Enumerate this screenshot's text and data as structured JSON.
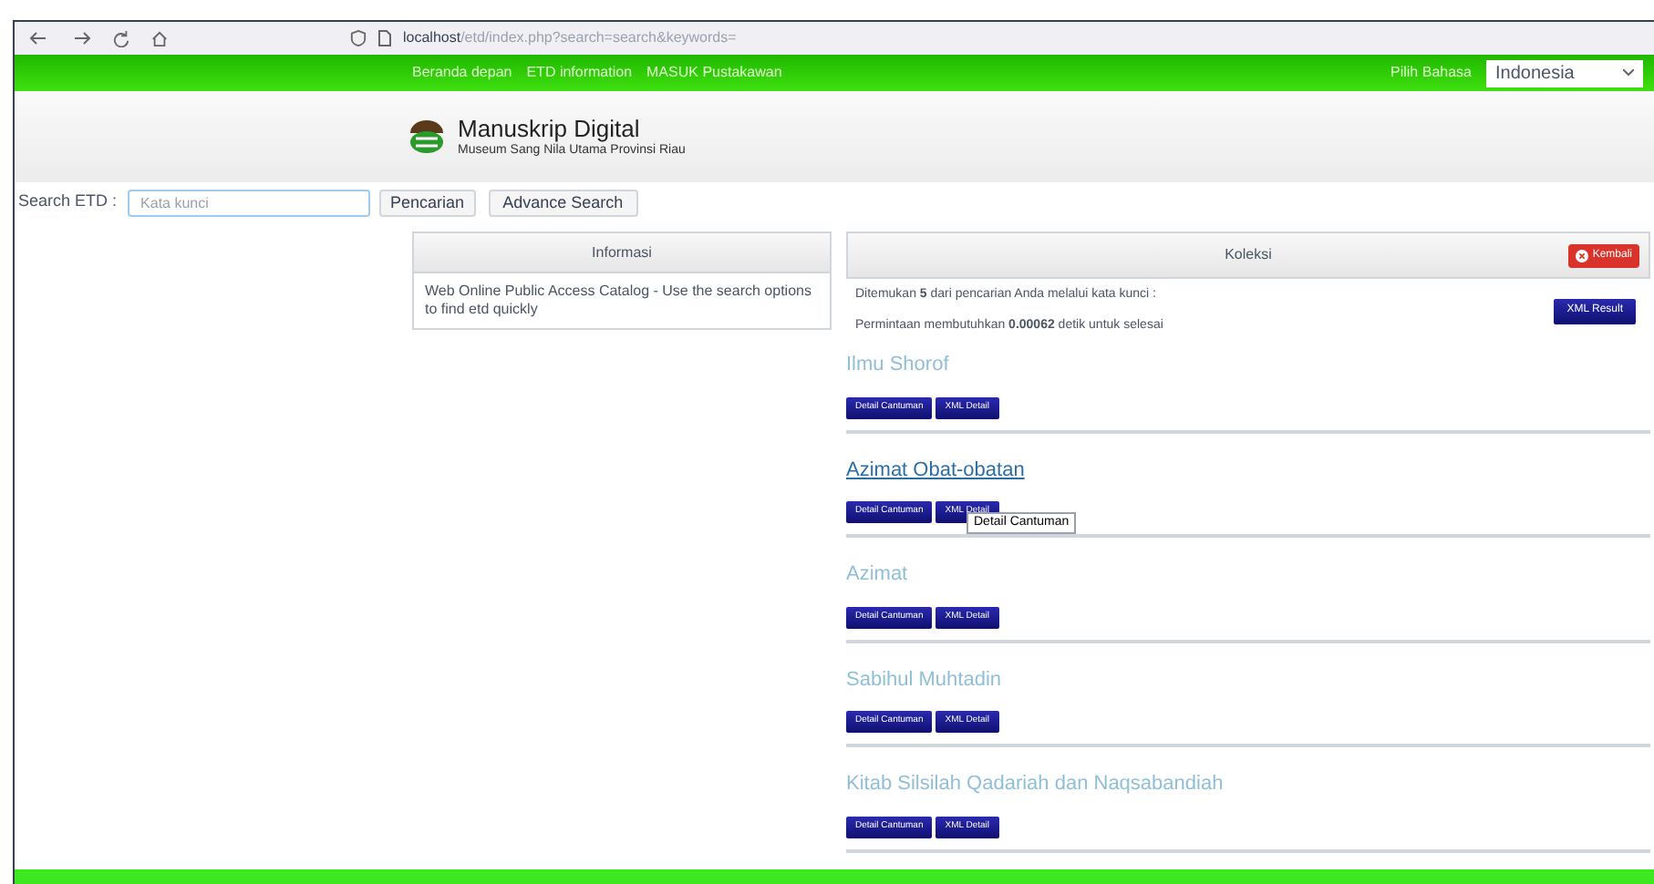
{
  "browser": {
    "url_host": "localhost",
    "url_path": "/etd/index.php?search=search&keywords="
  },
  "nav": {
    "links": [
      "Beranda depan",
      "ETD information",
      "MASUK Pustakawan"
    ],
    "language_label": "Pilih Bahasa",
    "language_value": "Indonesia"
  },
  "header": {
    "title": "Manuskrip Digital",
    "subtitle": "Museum Sang Nila Utama Provinsi Riau"
  },
  "search": {
    "label": "Search ETD :",
    "placeholder": "Kata kunci",
    "search_button": "Pencarian",
    "advance_button": "Advance Search"
  },
  "info_panel": {
    "title": "Informasi",
    "text": "Web Online Public Access Catalog - Use the search options to find etd quickly"
  },
  "collection": {
    "title": "Koleksi",
    "back_button": "Kembali",
    "found_text": "Ditemukan **5** dari pencarian Anda melalui kata kunci :",
    "time_text": "Permintaan membutuhkan **0.00062** detik untuk selesai",
    "xml_result_button": "XML Result",
    "items": [
      {
        "title": "Ilmu Shorof",
        "hovered": false,
        "buttons": [
          "Detail Cantuman",
          "XML Detail"
        ]
      },
      {
        "title": "Azimat Obat-obatan",
        "hovered": true,
        "buttons": [
          "Detail Cantuman",
          "XML Detail"
        ],
        "tooltip": "Detail Cantuman"
      },
      {
        "title": "Azimat",
        "hovered": false,
        "buttons": [
          "Detail Cantuman",
          "XML Detail"
        ]
      },
      {
        "title": "Sabihul Muhtadin",
        "hovered": false,
        "buttons": [
          "Detail Cantuman",
          "XML Detail"
        ]
      },
      {
        "title": "Kitab Silsilah Qadariah dan Naqsabandiah",
        "hovered": false,
        "buttons": [
          "Detail Cantuman",
          "XML Detail"
        ]
      }
    ]
  }
}
